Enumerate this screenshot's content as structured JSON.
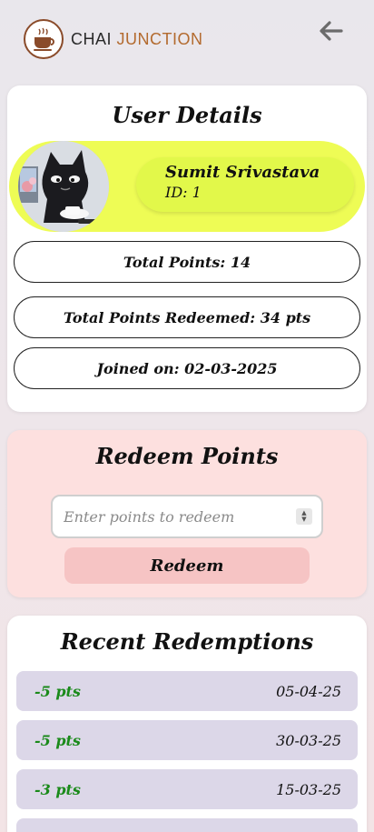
{
  "header": {
    "brand_word1": "CHAI",
    "brand_word2": "JUNCTION",
    "logo_icon": "coffee-cup-icon",
    "back_icon": "arrow-left-icon"
  },
  "user_details": {
    "title": "User Details",
    "name": "Sumit Srivastava",
    "id_text": "ID: 1",
    "total_points": "Total Points: 14",
    "total_redeemed": "Total Points Redeemed: 34 pts",
    "joined": "Joined on: 02-03-2025"
  },
  "redeem": {
    "title": "Redeem Points",
    "placeholder": "Enter points to redeem",
    "button_label": "Redeem"
  },
  "recent": {
    "title": "Recent Redemptions",
    "items": [
      {
        "points": "-5 pts",
        "date": "05-04-25"
      },
      {
        "points": "-5 pts",
        "date": "30-03-25"
      },
      {
        "points": "-3 pts",
        "date": "15-03-25"
      }
    ]
  },
  "colors": {
    "profile_band": "#eefc55",
    "redeem_card": "#fde0df",
    "points_green": "#1a8a1a",
    "row_bg": "#dcd7e8"
  }
}
